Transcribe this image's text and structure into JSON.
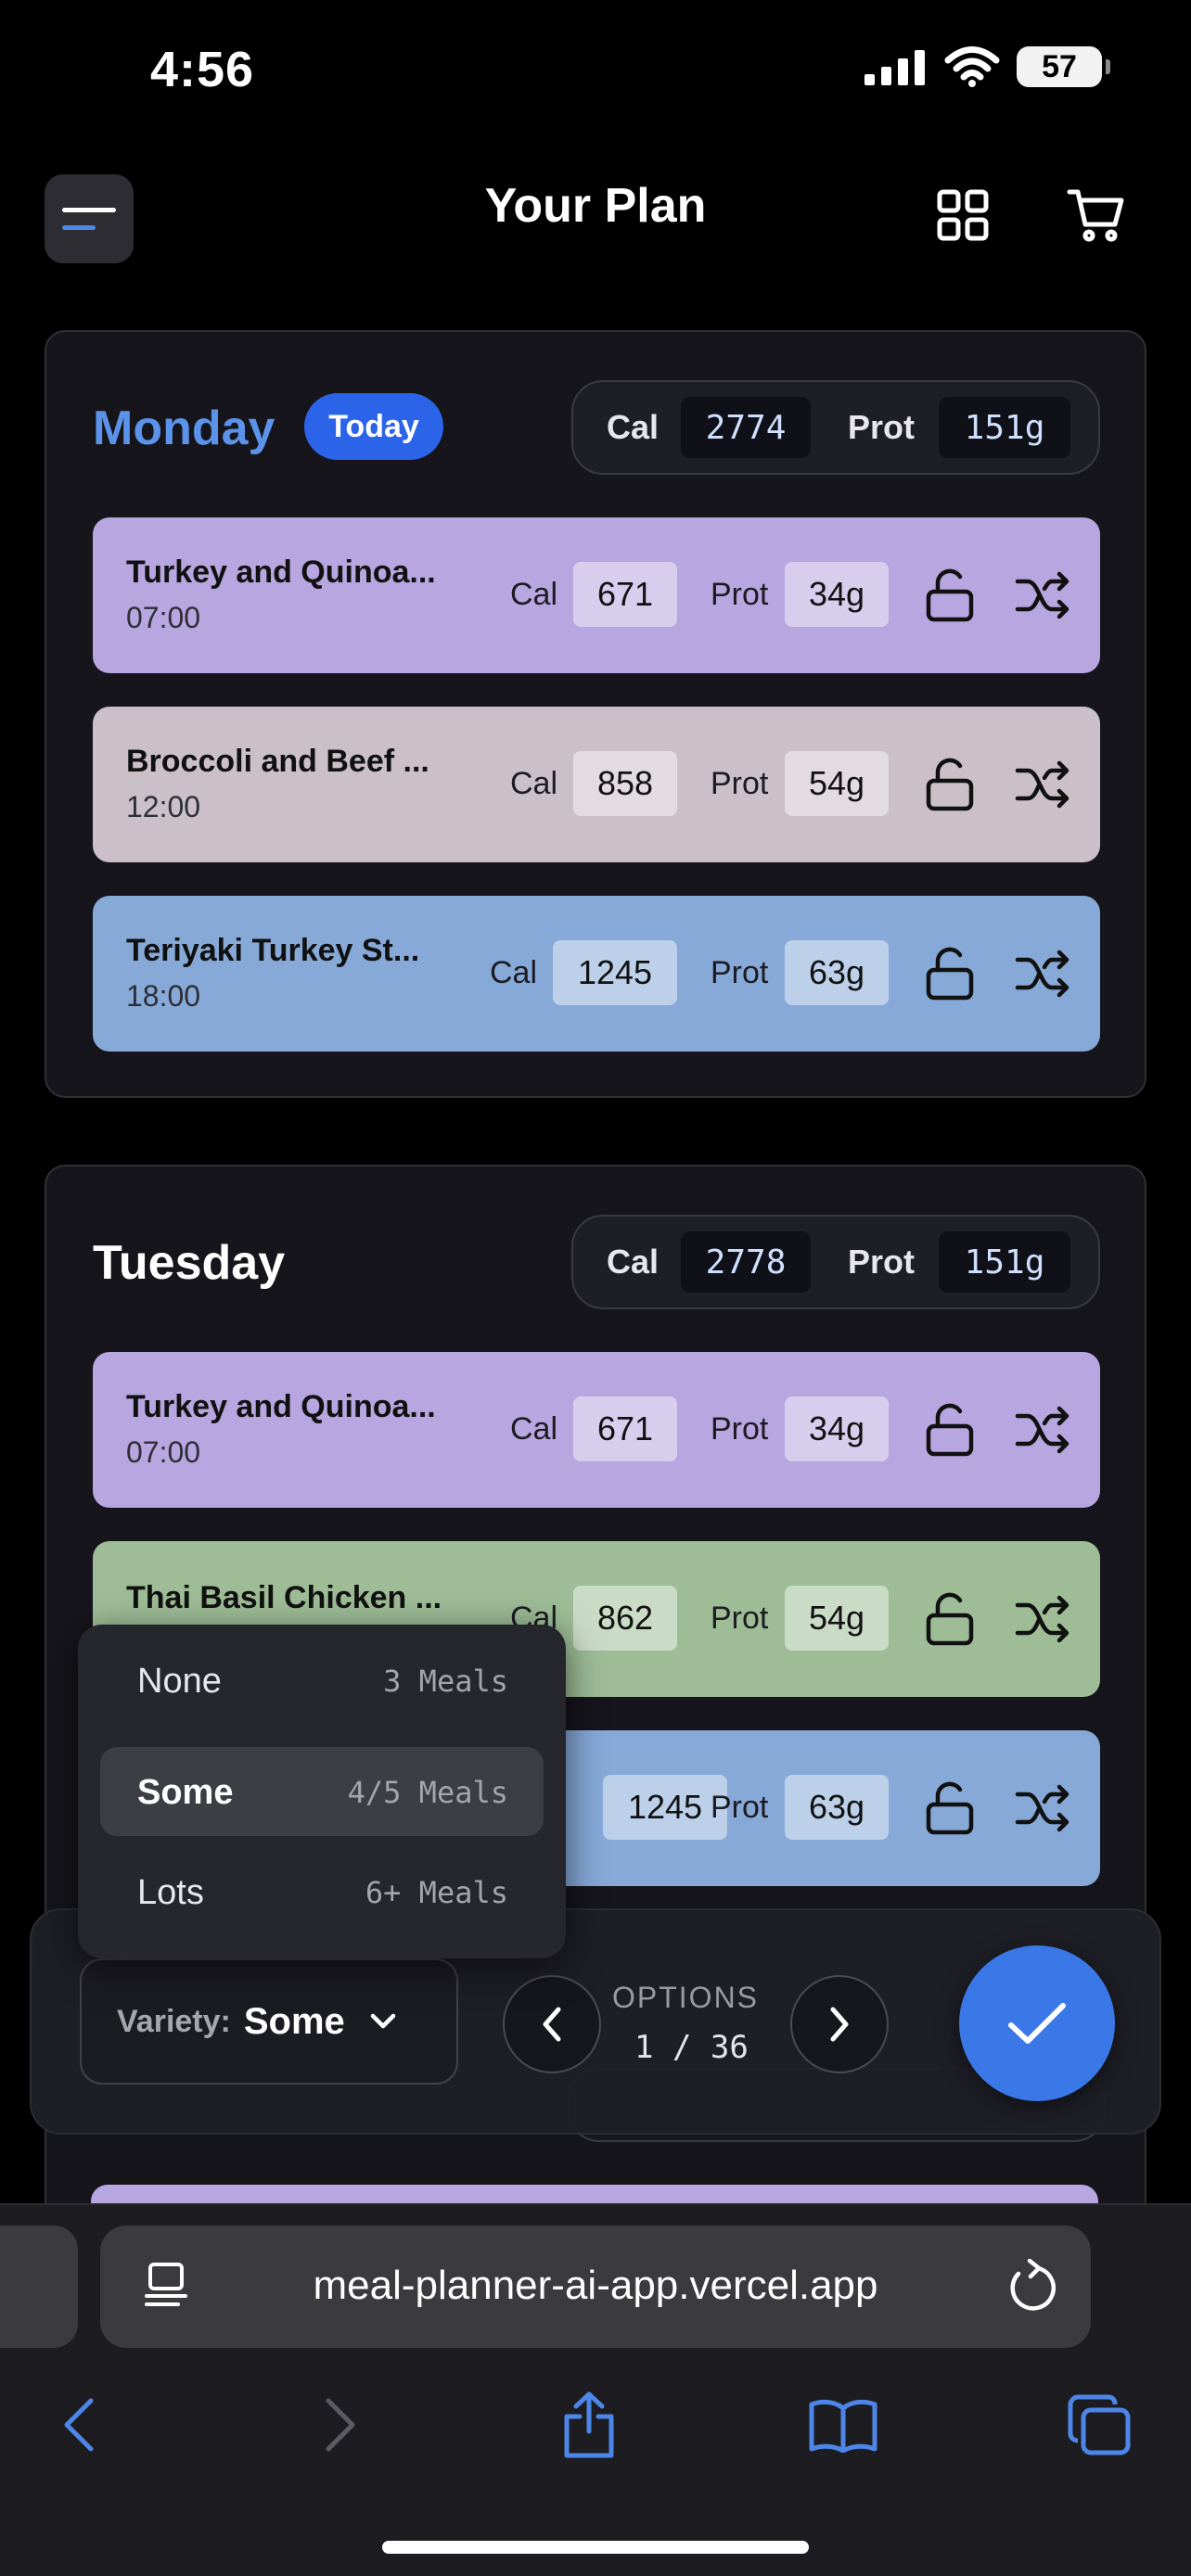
{
  "status_bar": {
    "time": "4:56",
    "battery": "57"
  },
  "header": {
    "title": "Your Plan"
  },
  "labels": {
    "cal": "Cal",
    "prot": "Prot"
  },
  "days": [
    {
      "name": "Monday",
      "badge": "Today",
      "total_cal": "2774",
      "total_prot": "151g",
      "meals": [
        {
          "name": "Turkey and Quinoa...",
          "time": "07:00",
          "cal": "671",
          "prot": "34g",
          "color": "#b7a6e0"
        },
        {
          "name": "Broccoli and Beef ...",
          "time": "12:00",
          "cal": "858",
          "prot": "54g",
          "color": "#cbbfc8"
        },
        {
          "name": "Teriyaki Turkey St...",
          "time": "18:00",
          "cal": "1245",
          "prot": "63g",
          "color": "#86a9d8"
        }
      ]
    },
    {
      "name": "Tuesday",
      "total_cal": "2778",
      "total_prot": "151g",
      "meals": [
        {
          "name": "Turkey and Quinoa...",
          "time": "07:00",
          "cal": "671",
          "prot": "34g",
          "color": "#b7a6e0"
        },
        {
          "name": "Thai Basil Chicken ...",
          "cal": "862",
          "prot": "54g",
          "color": "#9ebd97"
        },
        {
          "cal": "1245",
          "prot": "63g",
          "color": "#86a9d8"
        }
      ]
    }
  ],
  "variety_menu": {
    "options": [
      {
        "label": "None",
        "count": "3 Meals",
        "selected": false
      },
      {
        "label": "Some",
        "count": "4/5 Meals",
        "selected": true
      },
      {
        "label": "Lots",
        "count": "6+ Meals",
        "selected": false
      }
    ]
  },
  "controls": {
    "variety_label": "Variety:",
    "variety_value": "Some",
    "options_title": "OPTIONS",
    "options_count": "1 / 36"
  },
  "browser": {
    "url": "meal-planner-ai-app.vercel.app"
  },
  "colors": {
    "accent": "#2b64e8",
    "confirm": "#3a78e8",
    "monday_title": "#5b93ea",
    "icon_blue": "#4d86e8"
  },
  "icons": [
    "menu-icon",
    "grid-icon",
    "cart-icon",
    "lock-open-icon",
    "shuffle-icon",
    "chevron-down-icon",
    "chevron-left-icon",
    "chevron-right-icon",
    "check-icon",
    "reader-icon",
    "reload-icon",
    "back-icon",
    "forward-icon",
    "share-icon",
    "bookmarks-icon",
    "tabs-icon"
  ]
}
